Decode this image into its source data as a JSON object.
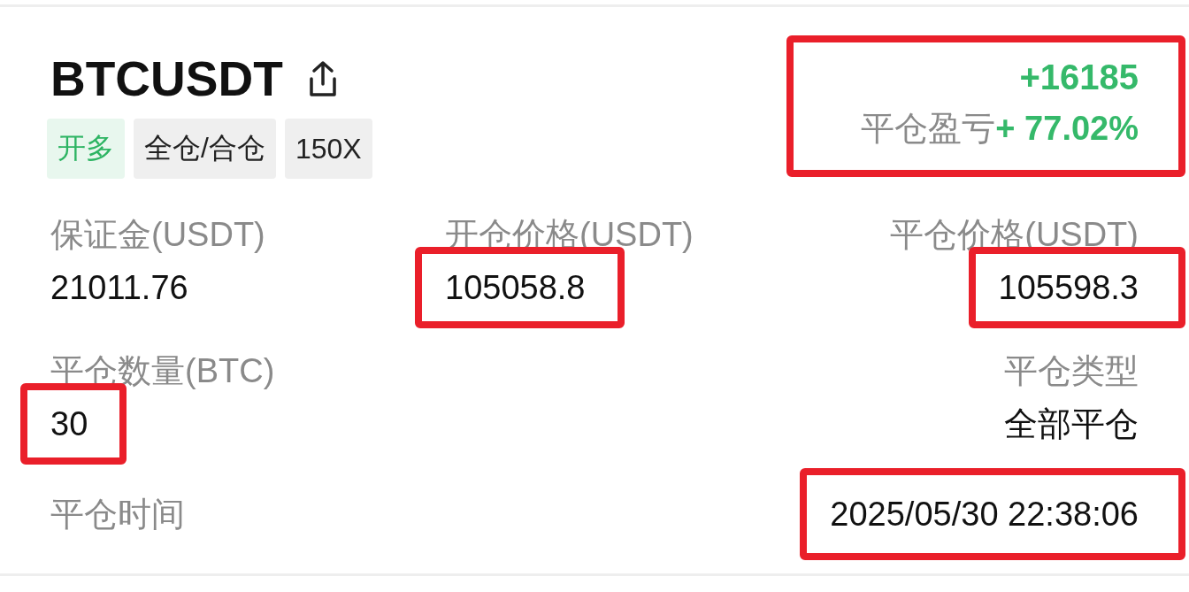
{
  "header": {
    "symbol": "BTCUSDT",
    "tags": [
      {
        "label": "开多",
        "kind": "direction"
      },
      {
        "label": "全仓/合仓",
        "kind": "mode"
      },
      {
        "label": "150X",
        "kind": "mode"
      }
    ],
    "pnl": {
      "amount": "+16185",
      "label": "平仓盈亏",
      "percent": "+ 77.02%",
      "highlighted": true
    }
  },
  "rows": [
    {
      "left": {
        "label": "保证金(USDT)",
        "value": "21011.76",
        "highlighted": false
      },
      "middle": {
        "label": "开仓价格(USDT)",
        "value": "105058.8",
        "highlighted": true
      },
      "right": {
        "label": "平仓价格(USDT)",
        "value": "105598.3",
        "highlighted": true
      }
    },
    {
      "left": {
        "label": "平仓数量(BTC)",
        "value": "30",
        "highlighted": true
      },
      "right": {
        "label": "平仓类型",
        "value": "全部平仓",
        "highlighted": false
      }
    },
    {
      "left": {
        "label": "平仓时间"
      },
      "right": {
        "value": "2025/05/30 22:38:06",
        "highlighted": true
      }
    }
  ]
}
